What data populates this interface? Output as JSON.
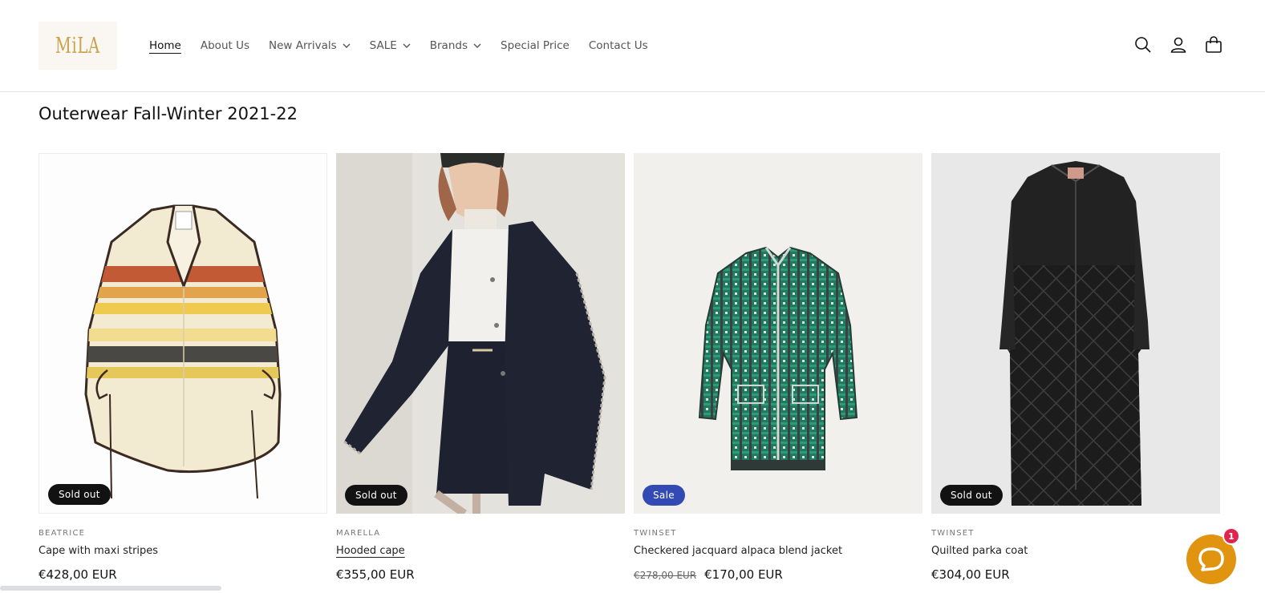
{
  "header": {
    "logo_text": "MiLA",
    "nav": [
      {
        "label": "Home",
        "active": true,
        "dropdown": false
      },
      {
        "label": "About Us",
        "active": false,
        "dropdown": false
      },
      {
        "label": "New Arrivals",
        "active": false,
        "dropdown": true
      },
      {
        "label": "SALE",
        "active": false,
        "dropdown": true
      },
      {
        "label": "Brands",
        "active": false,
        "dropdown": true
      },
      {
        "label": "Special Price",
        "active": false,
        "dropdown": false
      },
      {
        "label": "Contact Us",
        "active": false,
        "dropdown": false
      }
    ],
    "icons": [
      "search-icon",
      "account-icon",
      "cart-icon"
    ]
  },
  "collection": {
    "title": "Outerwear Fall-Winter 2021-22"
  },
  "products": [
    {
      "vendor": "BEATRICE",
      "name": "Cape with maxi stripes",
      "price": "€428,00 EUR",
      "compare_price": "",
      "badge": "Sold out",
      "badge_color": "#121212"
    },
    {
      "vendor": "MARELLA",
      "name": "Hooded cape",
      "price": "€355,00 EUR",
      "compare_price": "",
      "badge": "Sold out",
      "badge_color": "#121212"
    },
    {
      "vendor": "TWINSET",
      "name": "Checkered jacquard alpaca blend jacket",
      "price": "€170,00 EUR",
      "compare_price": "€278,00 EUR",
      "badge": "Sale",
      "badge_color": "#3349b4"
    },
    {
      "vendor": "TWINSET",
      "name": "Quilted parka coat",
      "price": "€304,00 EUR",
      "compare_price": "",
      "badge": "Sold out",
      "badge_color": "#121212"
    }
  ],
  "chat": {
    "notification_count": "1",
    "color": "#e09410"
  }
}
